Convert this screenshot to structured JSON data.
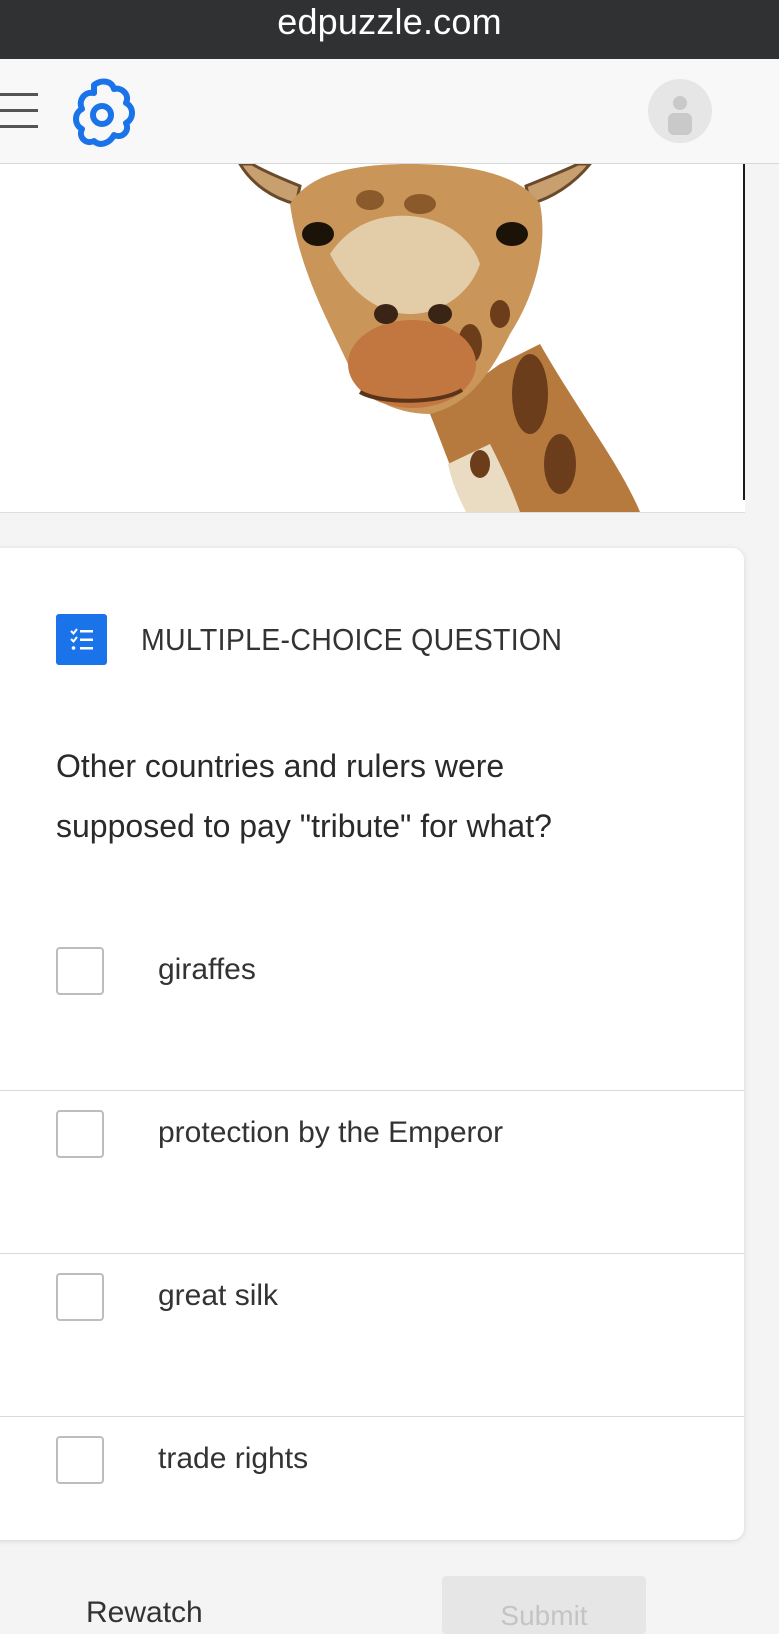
{
  "browser": {
    "domain": "edpuzzle.com"
  },
  "header": {
    "menu_icon": "hamburger-menu-icon",
    "logo_icon": "edpuzzle-logo-icon",
    "avatar_icon": "user-avatar-icon",
    "brand_color": "#1a73e8"
  },
  "video": {
    "subject": "giraffe"
  },
  "question": {
    "type_icon": "checklist-icon",
    "type_label": "MULTIPLE-CHOICE QUESTION",
    "line1": "Other countries and rulers were",
    "line2": "supposed to pay \"tribute\" for what?",
    "options": [
      {
        "label": "giraffes",
        "checked": false
      },
      {
        "label": "protection by the Emperor",
        "checked": false
      },
      {
        "label": "great silk",
        "checked": false
      },
      {
        "label": "trade rights",
        "checked": false
      }
    ]
  },
  "actions": {
    "rewatch_label": "Rewatch",
    "submit_label": "Submit"
  }
}
